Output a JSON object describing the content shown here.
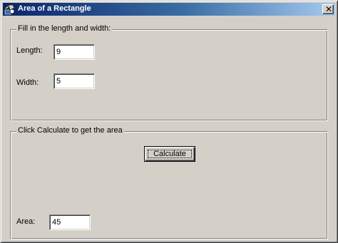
{
  "window": {
    "title": "Area of a Rectangle",
    "close_label": "✕"
  },
  "input_group": {
    "legend": "Fill in the length and width:",
    "length_label": "Length:",
    "length_value": "9",
    "width_label": "Width:",
    "width_value": "5"
  },
  "result_group": {
    "legend": "Click Calculate to get the area",
    "calculate_label": "Calculate",
    "area_label": "Area:",
    "area_value": "45"
  }
}
